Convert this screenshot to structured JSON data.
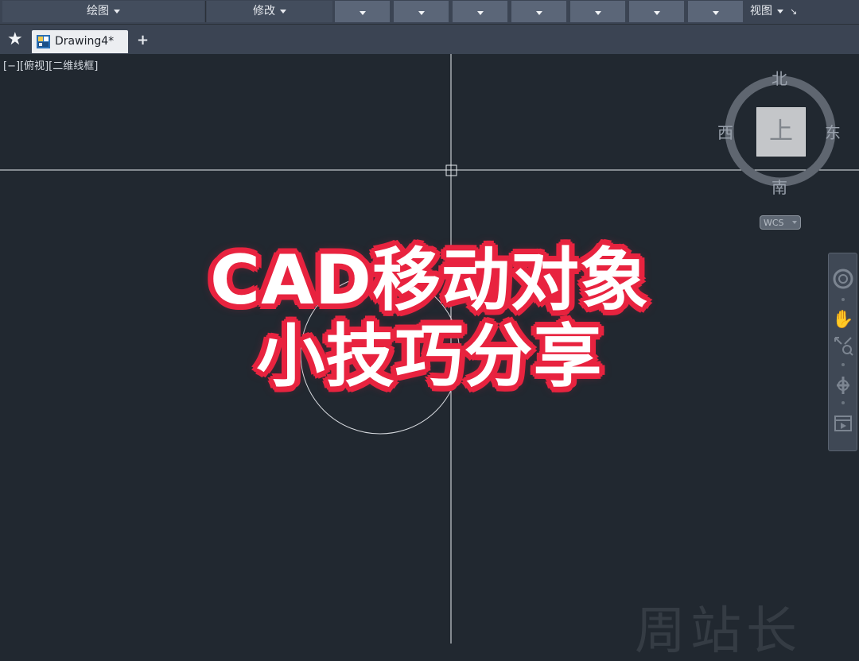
{
  "ribbon": {
    "panels": [
      {
        "label": "绘图"
      },
      {
        "label": "修改"
      },
      {
        "label": "视图"
      }
    ]
  },
  "tabs": {
    "start_icon": "star-icon",
    "document_tab": {
      "label": "Drawing4*",
      "icon": "drawing-file-icon"
    },
    "new_tab_label": "+"
  },
  "viewport": {
    "controls_label": "[−][俯视][二维线框]"
  },
  "viewcube": {
    "north": "北",
    "south": "南",
    "east": "东",
    "west": "西",
    "face": "上",
    "ucs_label": "WCS"
  },
  "navbar": {
    "tools": [
      "steering-wheel-icon",
      "pan-hand-icon",
      "zoom-extents-icon",
      "orbit-icon",
      "showmotion-icon"
    ]
  },
  "overlay": {
    "line1": "CAD移动对象",
    "line2": "小技巧分享",
    "stroke_color": "#e8233f",
    "fill_color": "#ffffff"
  },
  "watermark": "周站长",
  "colors": {
    "canvas_bg": "#212830",
    "ribbon_bg": "#3b4453",
    "crosshair": "#e8ebef"
  }
}
